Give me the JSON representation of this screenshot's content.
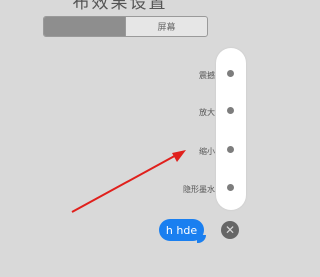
{
  "header": {
    "title": "布效果设置"
  },
  "segmented_control": {
    "segments": [
      "",
      "屏幕"
    ],
    "selected_index": 0
  },
  "effects": [
    {
      "label": "震撼"
    },
    {
      "label": "放大"
    },
    {
      "label": "缩小"
    },
    {
      "label": "隐形墨水"
    }
  ],
  "message_bubble": {
    "text": "h hde",
    "color": "#1a7ff0"
  },
  "close_button": {
    "icon": "close-icon",
    "glyph": "✕"
  },
  "annotation": {
    "arrow_color": "#e0201c"
  }
}
